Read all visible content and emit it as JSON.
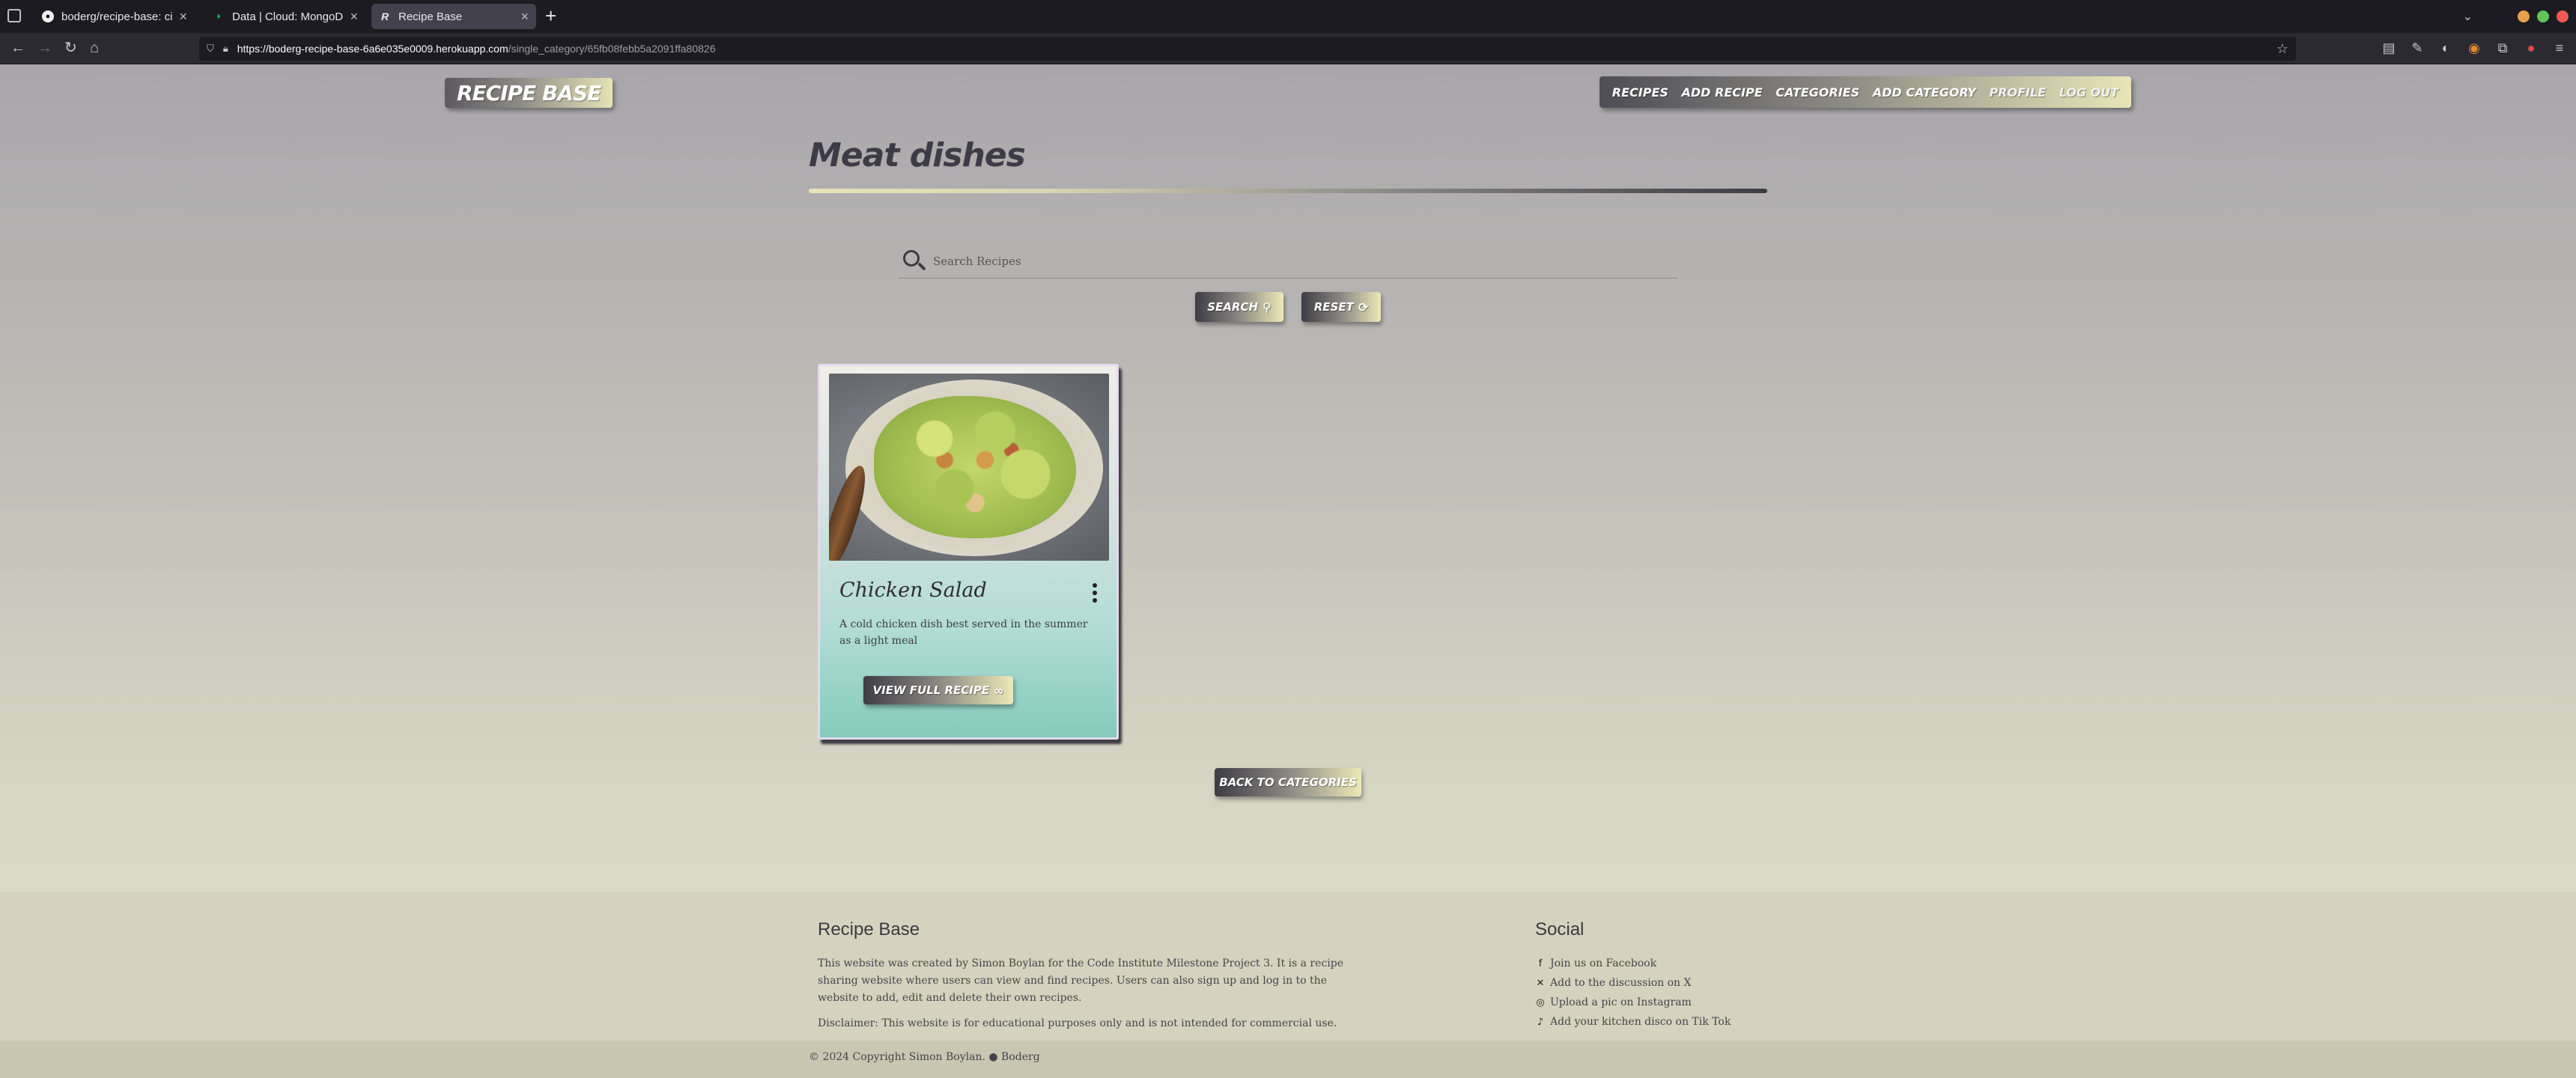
{
  "browser": {
    "tabs": [
      {
        "title": "boderg/recipe-base: ci mile",
        "favicon": "github-icon"
      },
      {
        "title": "Data | Cloud: MongoDB Clo",
        "favicon": "mongodb-leaf-icon"
      },
      {
        "title": "Recipe Base",
        "favicon": "recipe-base-icon",
        "active": true
      }
    ],
    "new_tab": "+",
    "url_host": "https://boderg-recipe-base-6a6e035e0009.herokuapp.com",
    "url_path": "/single_category/65fb08febb5a2091ffa80826",
    "window_colors": {
      "minimize": "#e9a04a",
      "maximize": "#61c554",
      "close": "#ee5a52"
    }
  },
  "site": {
    "brand": "RECIPE BASE",
    "nav": [
      "RECIPES",
      "ADD RECIPE",
      "CATEGORIES",
      "ADD CATEGORY",
      "PROFILE",
      "LOG OUT"
    ]
  },
  "category": {
    "title": "Meat dishes"
  },
  "search": {
    "placeholder": "Search Recipes",
    "search_label": "SEARCH",
    "reset_label": "RESET"
  },
  "recipes": [
    {
      "title": "Chicken Salad",
      "description": "A cold chicken dish best served in the summer as a light meal",
      "button": "VIEW FULL RECIPE"
    }
  ],
  "back_button": "BACK TO CATEGORIES",
  "footer": {
    "about_heading": "Recipe Base",
    "about_text": "This website was created by Simon Boylan for the Code Institute Milestone Project 3. It is a recipe sharing website where users can view and find recipes. Users can also sign up and log in to the website to add, edit and delete their own recipes.",
    "disclaimer": "Disclaimer: This website is for educational purposes only and is not intended for commercial use.",
    "social_heading": "Social",
    "social_links": [
      {
        "icon": "facebook-icon",
        "glyph": "f",
        "text": "Join us on Facebook"
      },
      {
        "icon": "x-icon",
        "glyph": "✕",
        "text": "Add to the discussion on X"
      },
      {
        "icon": "instagram-icon",
        "glyph": "◎",
        "text": "Upload a pic on Instagram"
      },
      {
        "icon": "tiktok-icon",
        "glyph": "♪",
        "text": "Add your kitchen disco on Tik Tok"
      }
    ],
    "copyright": "© 2024 Copyright Simon Boylan.",
    "github_name": "Boderg"
  }
}
